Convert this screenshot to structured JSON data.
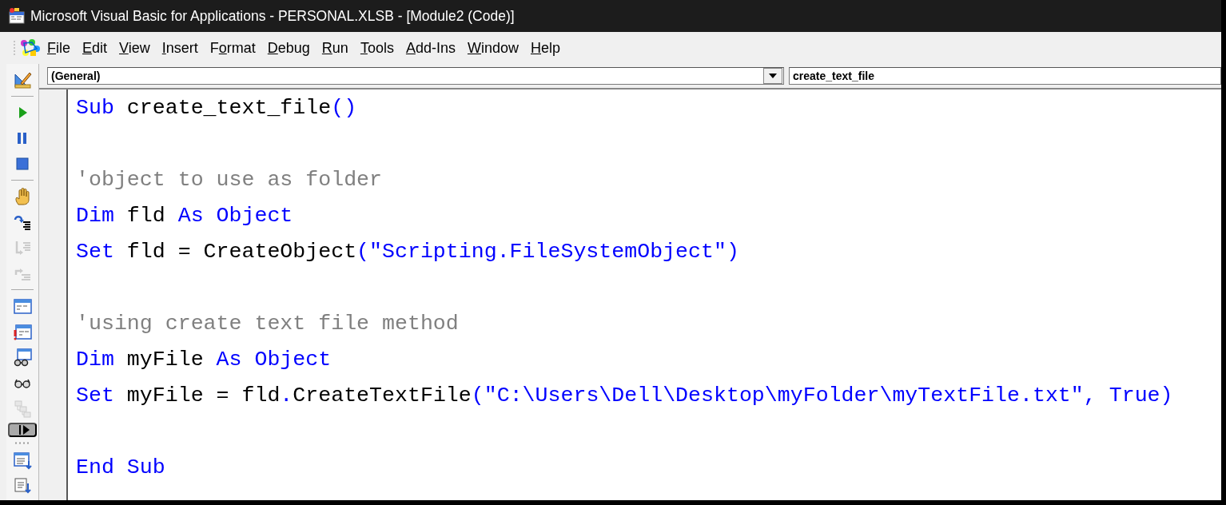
{
  "window": {
    "title": "Microsoft Visual Basic for Applications - PERSONAL.XLSB - [Module2 (Code)]"
  },
  "menu": [
    {
      "access_key": "F",
      "label_rest": "ile"
    },
    {
      "access_key": "E",
      "label_rest": "dit"
    },
    {
      "access_key": "V",
      "label_rest": "iew"
    },
    {
      "access_key": "I",
      "label_rest": "nsert"
    },
    {
      "label_start": "F",
      "access_key": "o",
      "label_rest": "rmat"
    },
    {
      "access_key": "D",
      "label_rest": "ebug"
    },
    {
      "access_key": "R",
      "label_rest": "un"
    },
    {
      "access_key": "T",
      "label_rest": "ools"
    },
    {
      "access_key": "A",
      "label_rest": "dd-Ins"
    },
    {
      "access_key": "W",
      "label_rest": "indow"
    },
    {
      "access_key": "H",
      "label_rest": "elp"
    }
  ],
  "toolbar": [
    {
      "kind": "design",
      "disabled": false
    },
    {
      "kind": "sep"
    },
    {
      "kind": "run",
      "disabled": false
    },
    {
      "kind": "pause",
      "disabled": false
    },
    {
      "kind": "stop",
      "disabled": false
    },
    {
      "kind": "sep"
    },
    {
      "kind": "hand",
      "disabled": false
    },
    {
      "kind": "stepin",
      "disabled": false
    },
    {
      "kind": "stepover",
      "disabled": true
    },
    {
      "kind": "stepout",
      "disabled": true
    },
    {
      "kind": "sep"
    },
    {
      "kind": "window",
      "disabled": false
    },
    {
      "kind": "window2",
      "disabled": false
    },
    {
      "kind": "watch",
      "disabled": false
    },
    {
      "kind": "glasses",
      "disabled": false
    },
    {
      "kind": "stack",
      "disabled": true
    },
    {
      "kind": "chevron"
    },
    {
      "kind": "grip"
    },
    {
      "kind": "listprop",
      "disabled": false
    },
    {
      "kind": "listprop2",
      "disabled": false
    }
  ],
  "object_dropdown": {
    "value": "(General)"
  },
  "procedure_dropdown": {
    "value": "create_text_file"
  },
  "code": [
    {
      "kind": "code",
      "tokens": [
        {
          "kind": "keyword",
          "text": "Sub"
        },
        {
          "kind": "plain",
          "text": " create_text_file"
        },
        {
          "kind": "keyword",
          "text": "()"
        }
      ]
    },
    {
      "kind": "blank"
    },
    {
      "kind": "code",
      "tokens": [
        {
          "kind": "comment",
          "text": "'object to use as folder"
        }
      ]
    },
    {
      "kind": "code",
      "tokens": [
        {
          "kind": "keyword",
          "text": "Dim"
        },
        {
          "kind": "plain",
          "text": " fld "
        },
        {
          "kind": "keyword",
          "text": "As Object"
        }
      ]
    },
    {
      "kind": "code",
      "tokens": [
        {
          "kind": "keyword",
          "text": "Set"
        },
        {
          "kind": "plain",
          "text": " fld = CreateObject"
        },
        {
          "kind": "keyword",
          "text": "(\"Scripting.FileSystemObject\")"
        }
      ]
    },
    {
      "kind": "blank"
    },
    {
      "kind": "code",
      "tokens": [
        {
          "kind": "comment",
          "text": "'using create text file method"
        }
      ]
    },
    {
      "kind": "code",
      "tokens": [
        {
          "kind": "keyword",
          "text": "Dim"
        },
        {
          "kind": "plain",
          "text": " myFile "
        },
        {
          "kind": "keyword",
          "text": "As Object"
        }
      ]
    },
    {
      "kind": "code",
      "tokens": [
        {
          "kind": "keyword",
          "text": "Set"
        },
        {
          "kind": "plain",
          "text": " myFile = fld"
        },
        {
          "kind": "keyword",
          "text": "."
        },
        {
          "kind": "plain",
          "text": "CreateTextFile"
        },
        {
          "kind": "keyword",
          "text": "(\"C:\\Users\\Dell\\Desktop\\myFolder\\myTextFile.txt\", True)"
        }
      ]
    },
    {
      "kind": "blank"
    },
    {
      "kind": "code",
      "tokens": [
        {
          "kind": "keyword",
          "text": "End Sub"
        }
      ]
    }
  ]
}
